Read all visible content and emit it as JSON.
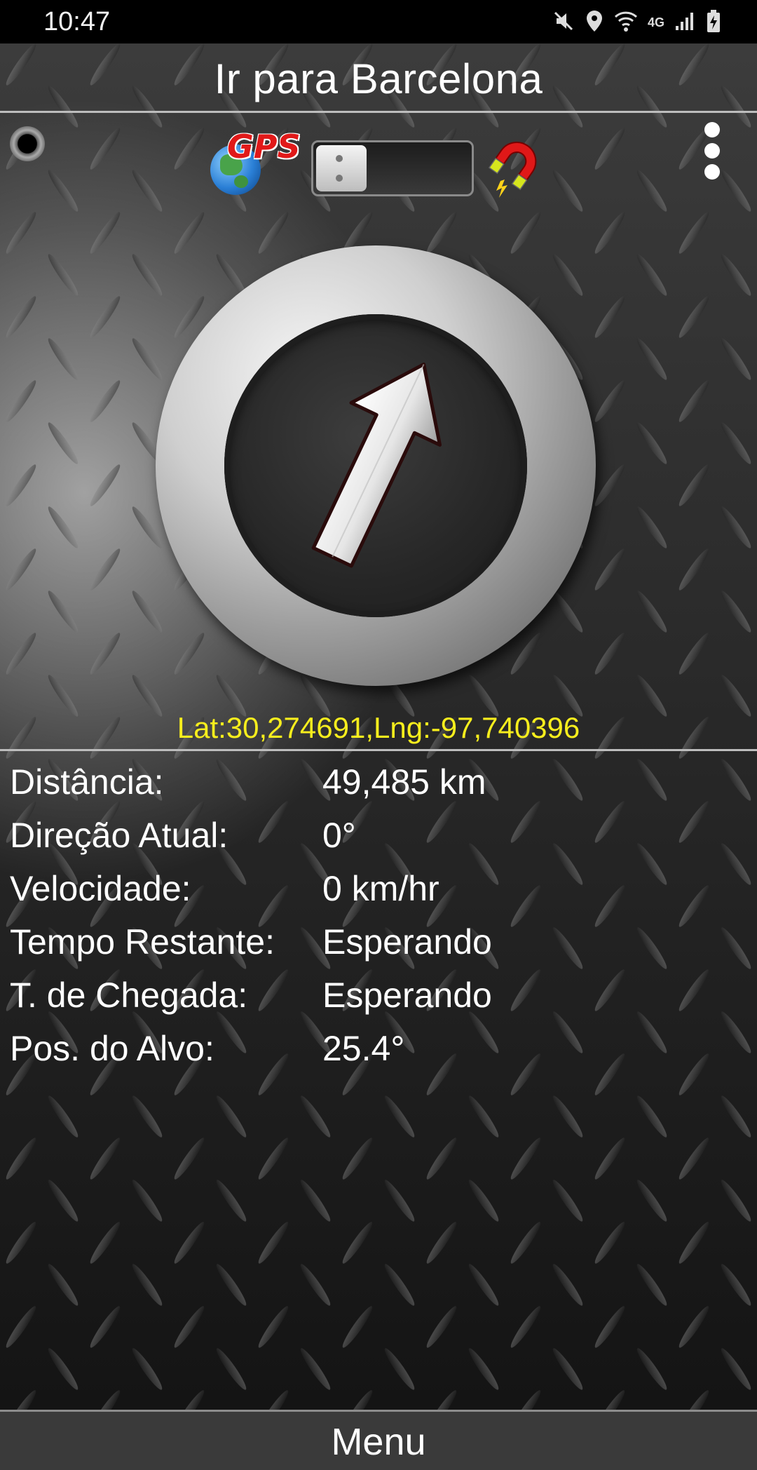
{
  "status_bar": {
    "time": "10:47",
    "icons": [
      "mute-icon",
      "location-icon",
      "wifi-icon",
      "4g-icon",
      "signal-icon",
      "battery-charging-icon"
    ],
    "network_label": "4G"
  },
  "header": {
    "title": "Ir para Barcelona"
  },
  "toolbar": {
    "gps_label": "GPS",
    "mode_toggle_on": false,
    "icons": [
      "status-led-icon",
      "gps-globe-icon",
      "magnet-icon",
      "overflow-menu-icon"
    ]
  },
  "compass": {
    "arrow_heading_deg": 25.4
  },
  "coordinates": "Lat:30,274691,Lng:-97,740396",
  "info_rows": [
    {
      "label": "Distância:",
      "value": "49,485 km"
    },
    {
      "label": "Direção Atual:",
      "value": "0°"
    },
    {
      "label": "Velocidade:",
      "value": "0 km/hr"
    },
    {
      "label": "Tempo Restante:",
      "value": "Esperando"
    },
    {
      "label": "T. de Chegada:",
      "value": "Esperando"
    },
    {
      "label": "Pos. do Alvo:",
      "value": "25.4°"
    }
  ],
  "menu": {
    "label": "Menu"
  },
  "colors": {
    "coordinates_text": "#f7ee1d",
    "gps_text": "#e11919",
    "text": "#ffffff"
  }
}
